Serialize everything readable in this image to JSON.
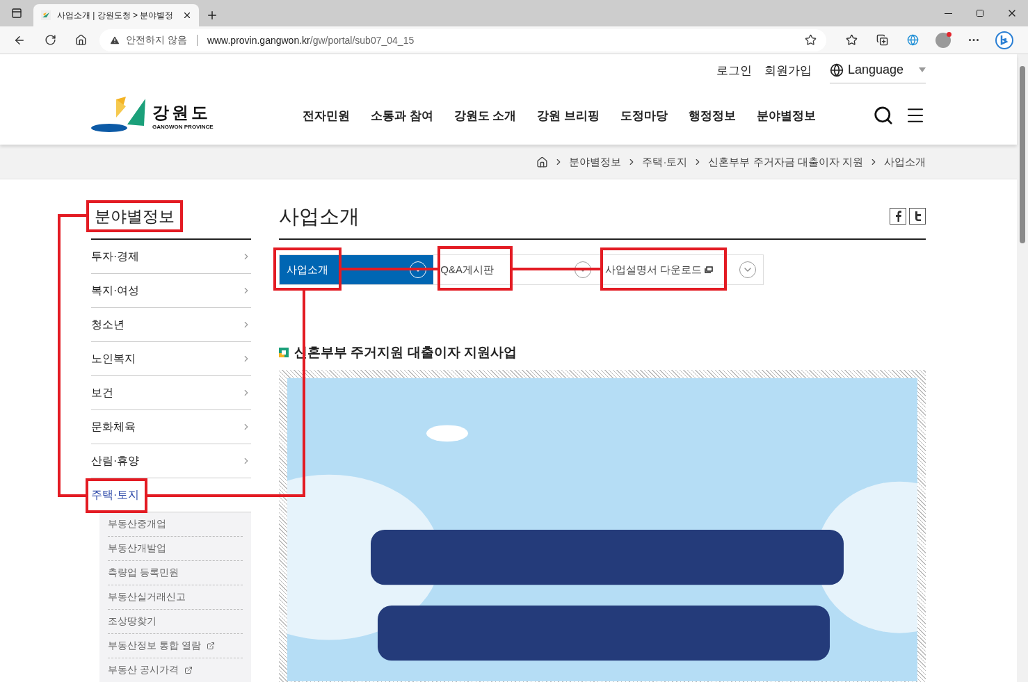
{
  "browser": {
    "tab_title": "사업소개 | 강원도청 > 분야별정",
    "security": "안전하지 않음",
    "url_host": "www.provin.gangwon.kr",
    "url_path": "/gw/portal/sub07_04_15"
  },
  "header": {
    "util_links": [
      "로그인",
      "회원가입"
    ],
    "language": "Language",
    "logo": {
      "name": "강원도",
      "subtitle": "GANGWON PROVINCE"
    },
    "nav": [
      "전자민원",
      "소통과 참여",
      "강원도 소개",
      "강원 브리핑",
      "도정마당",
      "행정정보",
      "분야별정보"
    ]
  },
  "breadcrumb": [
    "분야별정보",
    "주택·토지",
    "신혼부부 주거자금 대출이자 지원",
    "사업소개"
  ],
  "sidebar": {
    "title": "분야별정보",
    "items": [
      {
        "label": "투자·경제",
        "selected": false
      },
      {
        "label": "복지·여성",
        "selected": false
      },
      {
        "label": "청소년",
        "selected": false
      },
      {
        "label": "노인복지",
        "selected": false
      },
      {
        "label": "보건",
        "selected": false
      },
      {
        "label": "문화체육",
        "selected": false
      },
      {
        "label": "산림·휴양",
        "selected": false
      },
      {
        "label": "주택·토지",
        "selected": true,
        "children": [
          {
            "label": "부동산중개업",
            "external": false
          },
          {
            "label": "부동산개발업",
            "external": false
          },
          {
            "label": "측량업 등록민원",
            "external": false
          },
          {
            "label": "부동산실거래신고",
            "external": false
          },
          {
            "label": "조상땅찾기",
            "external": false
          },
          {
            "label": "부동산정보 통합 열람",
            "external": true
          },
          {
            "label": "부동산 공시가격",
            "external": true
          }
        ]
      }
    ]
  },
  "main": {
    "title": "사업소개",
    "tabs": [
      {
        "label": "사업소개",
        "selected": true,
        "external": false
      },
      {
        "label": "Q&A게시판",
        "selected": false,
        "external": false
      },
      {
        "label": "사업설명서 다운로드",
        "selected": false,
        "external": true
      }
    ],
    "section_heading": "신혼부부 주거지원 대출이자 지원사업"
  }
}
